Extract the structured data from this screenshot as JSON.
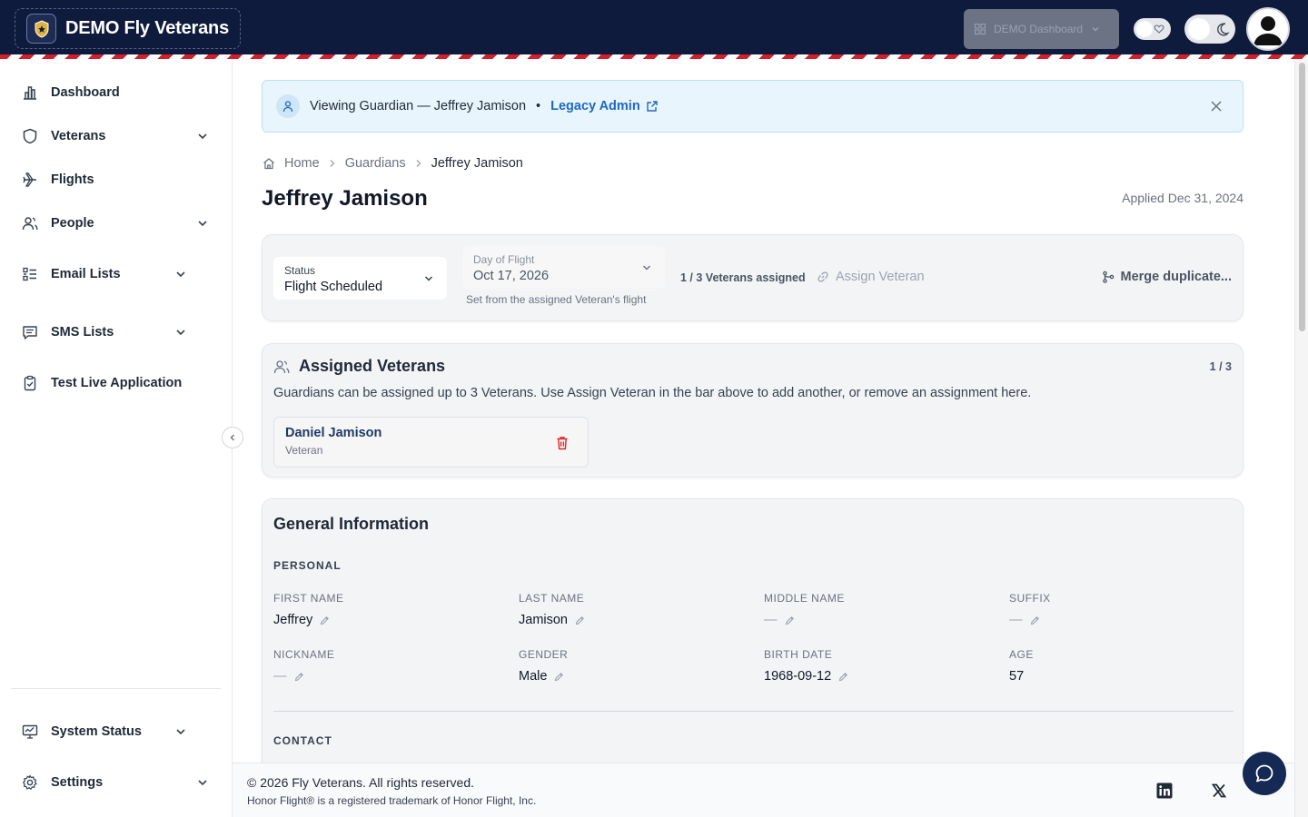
{
  "app": {
    "brand": "DEMO Fly Veterans"
  },
  "header": {
    "dashboard_select": "DEMO Dashboard"
  },
  "sidebar": {
    "items": [
      {
        "label": "Dashboard"
      },
      {
        "label": "Veterans"
      },
      {
        "label": "Flights"
      },
      {
        "label": "People"
      },
      {
        "label": "Email Lists"
      },
      {
        "label": "SMS Lists"
      },
      {
        "label": "Test Live Application"
      }
    ],
    "bottom": [
      {
        "label": "System Status"
      },
      {
        "label": "Settings"
      }
    ]
  },
  "banner": {
    "text": "Viewing Guardian — Jeffrey Jamison",
    "separator": "•",
    "link": "Legacy Admin"
  },
  "breadcrumb": {
    "home": "Home",
    "section": "Guardians",
    "current": "Jeffrey Jamison"
  },
  "page": {
    "title": "Jeffrey Jamison",
    "applied": "Applied Dec 31, 2024"
  },
  "status_bar": {
    "status_label": "Status",
    "status_value": "Flight Scheduled",
    "dof_label": "Day of Flight",
    "dof_value": "Oct 17, 2026",
    "dof_hint": "Set from the assigned Veteran's flight",
    "assigned_count": "1 / 3 Veterans assigned",
    "assign_button": "Assign Veteran",
    "merge_button": "Merge duplicate..."
  },
  "assigned": {
    "title": "Assigned Veterans",
    "count": "1 / 3",
    "description": "Guardians can be assigned up to 3 Veterans. Use Assign Veteran in the bar above to add another, or remove an assignment here.",
    "items": [
      {
        "name": "Daniel Jamison",
        "role": "Veteran"
      }
    ]
  },
  "general": {
    "title": "General Information",
    "personal_label": "PERSONAL",
    "contact_label": "CONTACT",
    "fields": {
      "first_name": {
        "label": "FIRST NAME",
        "value": "Jeffrey"
      },
      "last_name": {
        "label": "LAST NAME",
        "value": "Jamison"
      },
      "middle_name": {
        "label": "MIDDLE NAME",
        "value": "—"
      },
      "suffix": {
        "label": "SUFFIX",
        "value": "—"
      },
      "nickname": {
        "label": "NICKNAME",
        "value": "—"
      },
      "gender": {
        "label": "GENDER",
        "value": "Male"
      },
      "birth_date": {
        "label": "BIRTH DATE",
        "value": "1968-09-12"
      },
      "age": {
        "label": "AGE",
        "value": "57"
      }
    }
  },
  "footer": {
    "copyright": "© 2026 Fly Veterans. All rights reserved.",
    "trademark": "Honor Flight® is a registered trademark of Honor Flight, Inc."
  },
  "colors": {
    "navy": "#0f1b3d",
    "accent_red": "#d21f2a",
    "link_blue": "#1d68c2",
    "danger": "#dc2626"
  }
}
